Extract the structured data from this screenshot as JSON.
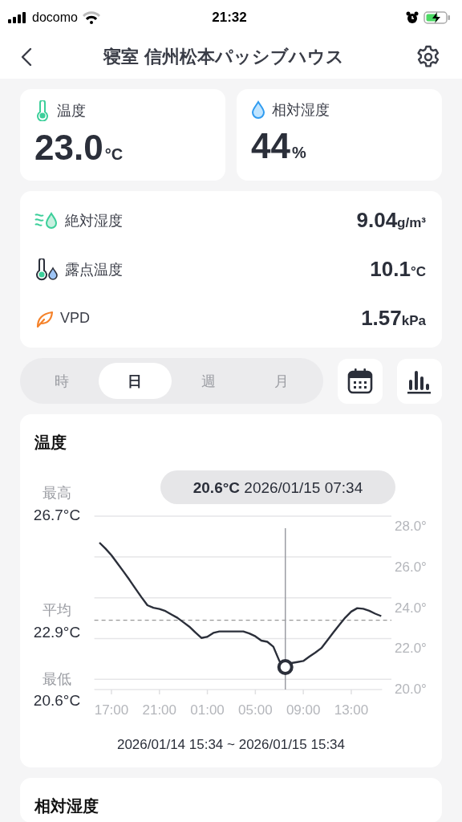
{
  "status_bar": {
    "carrier": "docomo",
    "time": "21:32"
  },
  "header": {
    "title": "寝室 信州松本パッシブハウス"
  },
  "metrics": [
    {
      "label": "温度",
      "value": "23.0",
      "unit": "°C"
    },
    {
      "label": "相対湿度",
      "value": "44",
      "unit": "%"
    }
  ],
  "details": [
    {
      "label": "絶対湿度",
      "value": "9.04",
      "unit": "g/m³"
    },
    {
      "label": "露点温度",
      "value": "10.1",
      "unit": "°C"
    },
    {
      "label": "VPD",
      "value": "1.57",
      "unit": "kPa"
    }
  ],
  "periods": [
    {
      "label": "時",
      "selected": false
    },
    {
      "label": "日",
      "selected": true
    },
    {
      "label": "週",
      "selected": false
    },
    {
      "label": "月",
      "selected": false
    }
  ],
  "temperature_card": {
    "tooltip": {
      "value": "20.6°C",
      "time": "2026/01/15 07:34"
    },
    "stats": [
      {
        "label": "最高",
        "value": "26.7°C"
      },
      {
        "label": "平均",
        "value": "22.9°C"
      },
      {
        "label": "最低",
        "value": "20.6°C"
      }
    ],
    "chart_data": {
      "type": "line",
      "title": "温度",
      "categories": [
        null,
        null,
        "17:00",
        null,
        null,
        null,
        null,
        null,
        null,
        null,
        "21:00",
        null,
        null,
        null,
        null,
        null,
        null,
        null,
        "01:00",
        null,
        null,
        null,
        null,
        null,
        null,
        null,
        "05:00",
        null,
        null,
        null,
        null,
        null,
        null,
        null,
        "09:00",
        null,
        null,
        null,
        null,
        null,
        null,
        null,
        "13:00",
        null,
        null,
        null,
        null,
        null
      ],
      "series": [
        {
          "color": "#2b2f3a",
          "values": [
            26.7,
            26.41,
            26.08,
            25.69,
            25.29,
            24.88,
            24.45,
            24.03,
            23.63,
            23.51,
            23.45,
            23.35,
            23.18,
            23.02,
            22.8,
            22.58,
            22.3,
            22.03,
            22.09,
            22.28,
            22.35,
            22.35,
            22.35,
            22.35,
            22.35,
            22.25,
            22.11,
            21.9,
            21.84,
            21.6,
            20.9,
            20.6,
            20.8,
            20.85,
            20.9,
            21.11,
            21.31,
            21.53,
            21.91,
            22.29,
            22.67,
            23.03,
            23.32,
            23.49,
            23.46,
            23.36,
            23.22,
            23.1
          ]
        }
      ],
      "ylim": [
        19.5,
        28
      ],
      "yticks": [
        {
          "value": 20,
          "label": "20.0°"
        },
        {
          "value": 22,
          "label": "22.0°"
        },
        {
          "value": 24,
          "label": "24.0°"
        },
        {
          "value": 26,
          "label": "26.0°"
        },
        {
          "value": 28,
          "label": "28.0°"
        }
      ],
      "grid": true,
      "ref_lines": [
        {
          "value": 22.9,
          "axis": "y"
        }
      ]
    },
    "range": "2026/01/14 15:34 ~ 2026/01/15 15:34"
  },
  "humidity_card": {
    "title": "相対湿度"
  }
}
